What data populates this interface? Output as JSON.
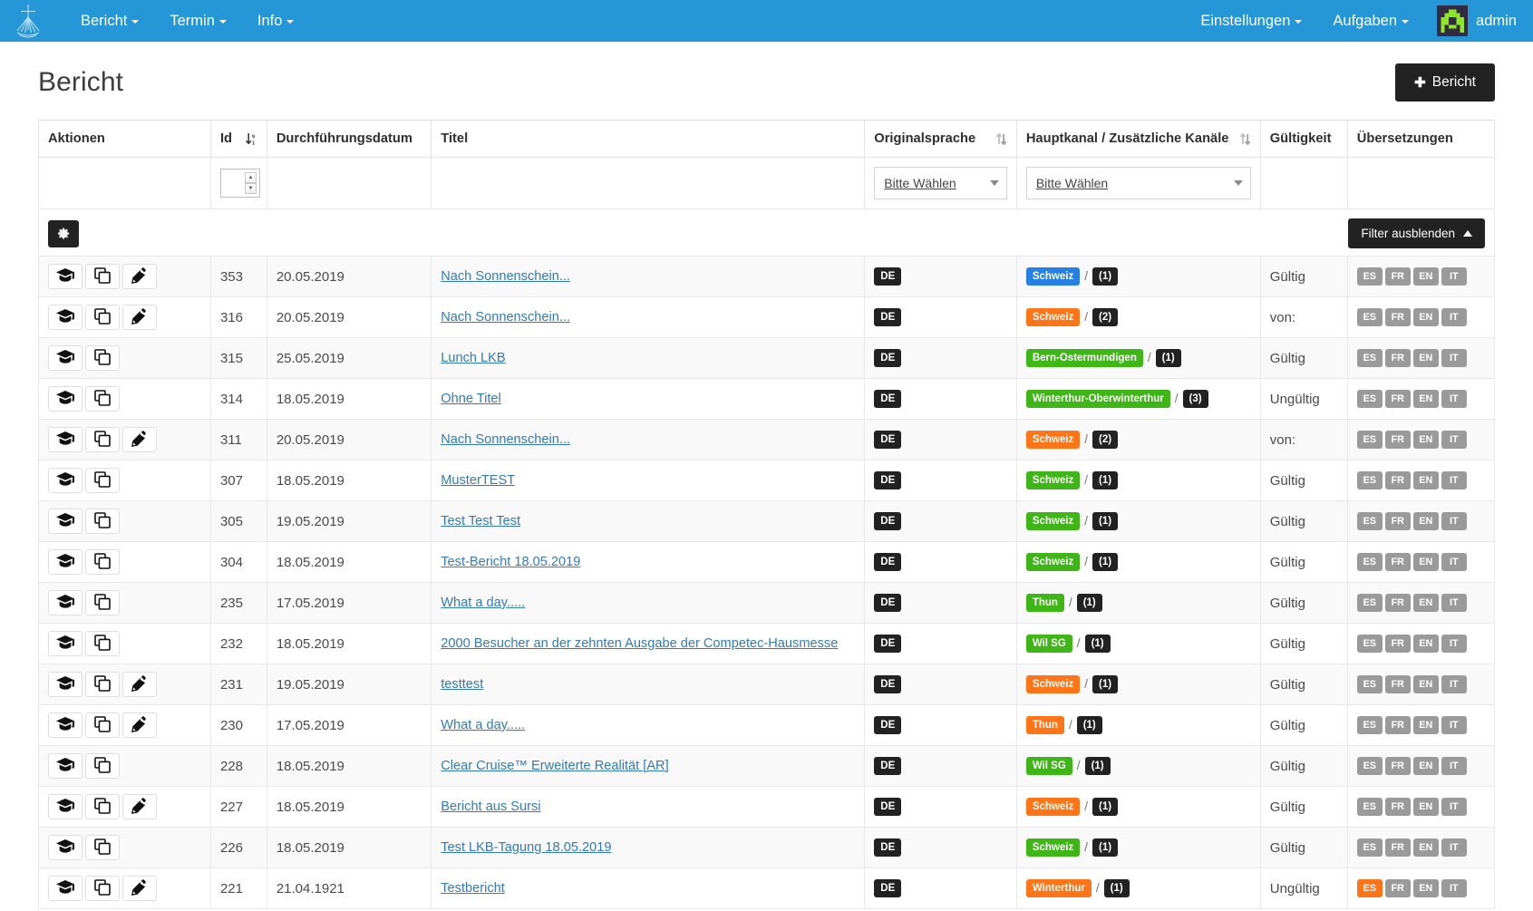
{
  "navbar": {
    "brand_icon": "cross-rays-logo",
    "left_items": [
      {
        "label": "Bericht",
        "icon": "chevron-down-icon"
      },
      {
        "label": "Termin",
        "icon": "chevron-down-icon"
      },
      {
        "label": "Info",
        "icon": "chevron-down-icon"
      }
    ],
    "right_items": [
      {
        "label": "Einstellungen",
        "icon": "chevron-down-icon"
      },
      {
        "label": "Aufgaben",
        "icon": "chevron-down-icon"
      }
    ],
    "username": "admin",
    "bg_color": "#2596d6"
  },
  "page": {
    "title": "Bericht",
    "new_button": {
      "label": "Bericht",
      "icon": "plus-icon"
    }
  },
  "toolbar": {
    "settings_icon": "gear-icon",
    "filter_toggle_label": "Filter ausblenden",
    "filter_toggle_icon": "chevron-up-icon"
  },
  "table": {
    "columns": [
      {
        "label": "Aktionen",
        "sortable": false
      },
      {
        "label": "Id",
        "sortable": true,
        "sort_state": "desc"
      },
      {
        "label": "Durchführungsdatum",
        "sortable": false
      },
      {
        "label": "Titel",
        "sortable": false
      },
      {
        "label": "Originalsprache",
        "sortable": true,
        "sort_state": "none"
      },
      {
        "label": "Hauptkanal / Zusätzliche Kanäle",
        "sortable": true,
        "sort_state": "none"
      },
      {
        "label": "Gültigkeit",
        "sortable": false
      },
      {
        "label": "Übersetzungen",
        "sortable": false
      }
    ],
    "filters": {
      "id_value": "",
      "originalsprache_placeholder": "Bitte Wählen",
      "hauptkanal_placeholder": "Bitte Wählen"
    },
    "rows": [
      {
        "actions": [
          "graduation-cap-icon",
          "copy-icon",
          "pencil-icon"
        ],
        "id": "353",
        "date": "20.05.2019",
        "title": "Nach Sonnenschein...",
        "lang": "DE",
        "channel": "Schweiz",
        "channel_color": "blue",
        "extra_count": "(1)",
        "validity": "Gültig",
        "translations": [
          {
            "label": "ES",
            "color": "gray"
          },
          {
            "label": "FR",
            "color": "gray"
          },
          {
            "label": "EN",
            "color": "gray"
          },
          {
            "label": "IT",
            "color": "gray"
          }
        ]
      },
      {
        "actions": [
          "graduation-cap-icon",
          "copy-icon",
          "pencil-icon"
        ],
        "id": "316",
        "date": "20.05.2019",
        "title": "Nach Sonnenschein...",
        "lang": "DE",
        "channel": "Schweiz",
        "channel_color": "orange",
        "extra_count": "(2)",
        "validity": "von:",
        "translations": [
          {
            "label": "ES",
            "color": "gray"
          },
          {
            "label": "FR",
            "color": "gray"
          },
          {
            "label": "EN",
            "color": "gray"
          },
          {
            "label": "IT",
            "color": "gray"
          }
        ]
      },
      {
        "actions": [
          "graduation-cap-icon",
          "copy-icon"
        ],
        "id": "315",
        "date": "25.05.2019",
        "title": "Lunch LKB",
        "lang": "DE",
        "channel": "Bern-Ostermundigen",
        "channel_color": "green",
        "extra_count": "(1)",
        "validity": "Gültig",
        "translations": [
          {
            "label": "ES",
            "color": "gray"
          },
          {
            "label": "FR",
            "color": "gray"
          },
          {
            "label": "EN",
            "color": "gray"
          },
          {
            "label": "IT",
            "color": "gray"
          }
        ]
      },
      {
        "actions": [
          "graduation-cap-icon",
          "copy-icon"
        ],
        "id": "314",
        "date": "18.05.2019",
        "title": "Ohne Titel",
        "lang": "DE",
        "channel": "Winterthur-Oberwinterthur",
        "channel_color": "green",
        "extra_count": "(3)",
        "validity": "Ungültig",
        "translations": [
          {
            "label": "ES",
            "color": "gray"
          },
          {
            "label": "FR",
            "color": "gray"
          },
          {
            "label": "EN",
            "color": "gray"
          },
          {
            "label": "IT",
            "color": "gray"
          }
        ]
      },
      {
        "actions": [
          "graduation-cap-icon",
          "copy-icon",
          "pencil-icon"
        ],
        "id": "311",
        "date": "20.05.2019",
        "title": "Nach Sonnenschein...",
        "lang": "DE",
        "channel": "Schweiz",
        "channel_color": "orange",
        "extra_count": "(2)",
        "validity": "von:",
        "translations": [
          {
            "label": "ES",
            "color": "gray"
          },
          {
            "label": "FR",
            "color": "gray"
          },
          {
            "label": "EN",
            "color": "gray"
          },
          {
            "label": "IT",
            "color": "gray"
          }
        ]
      },
      {
        "actions": [
          "graduation-cap-icon",
          "copy-icon"
        ],
        "id": "307",
        "date": "18.05.2019",
        "title": "MusterTEST",
        "lang": "DE",
        "channel": "Schweiz",
        "channel_color": "green",
        "extra_count": "(1)",
        "validity": "Gültig",
        "translations": [
          {
            "label": "ES",
            "color": "gray"
          },
          {
            "label": "FR",
            "color": "gray"
          },
          {
            "label": "EN",
            "color": "gray"
          },
          {
            "label": "IT",
            "color": "gray"
          }
        ]
      },
      {
        "actions": [
          "graduation-cap-icon",
          "copy-icon"
        ],
        "id": "305",
        "date": "19.05.2019",
        "title": "Test Test Test",
        "lang": "DE",
        "channel": "Schweiz",
        "channel_color": "green",
        "extra_count": "(1)",
        "validity": "Gültig",
        "translations": [
          {
            "label": "ES",
            "color": "gray"
          },
          {
            "label": "FR",
            "color": "gray"
          },
          {
            "label": "EN",
            "color": "gray"
          },
          {
            "label": "IT",
            "color": "gray"
          }
        ]
      },
      {
        "actions": [
          "graduation-cap-icon",
          "copy-icon"
        ],
        "id": "304",
        "date": "18.05.2019",
        "title": "Test-Bericht 18.05.2019",
        "lang": "DE",
        "channel": "Schweiz",
        "channel_color": "green",
        "extra_count": "(1)",
        "validity": "Gültig",
        "translations": [
          {
            "label": "ES",
            "color": "gray"
          },
          {
            "label": "FR",
            "color": "gray"
          },
          {
            "label": "EN",
            "color": "gray"
          },
          {
            "label": "IT",
            "color": "gray"
          }
        ]
      },
      {
        "actions": [
          "graduation-cap-icon",
          "copy-icon"
        ],
        "id": "235",
        "date": "17.05.2019",
        "title": "What a day.....",
        "lang": "DE",
        "channel": "Thun",
        "channel_color": "green",
        "extra_count": "(1)",
        "validity": "Gültig",
        "translations": [
          {
            "label": "ES",
            "color": "gray"
          },
          {
            "label": "FR",
            "color": "gray"
          },
          {
            "label": "EN",
            "color": "gray"
          },
          {
            "label": "IT",
            "color": "gray"
          }
        ]
      },
      {
        "actions": [
          "graduation-cap-icon",
          "copy-icon"
        ],
        "id": "232",
        "date": "18.05.2019",
        "title": "2000 Besucher an der zehnten Ausgabe der Competec-Hausmesse",
        "lang": "DE",
        "channel": "Wil SG",
        "channel_color": "green",
        "extra_count": "(1)",
        "validity": "Gültig",
        "translations": [
          {
            "label": "ES",
            "color": "gray"
          },
          {
            "label": "FR",
            "color": "gray"
          },
          {
            "label": "EN",
            "color": "gray"
          },
          {
            "label": "IT",
            "color": "gray"
          }
        ]
      },
      {
        "actions": [
          "graduation-cap-icon",
          "copy-icon",
          "pencil-icon"
        ],
        "id": "231",
        "date": "19.05.2019",
        "title": "testtest",
        "lang": "DE",
        "channel": "Schweiz",
        "channel_color": "orange",
        "extra_count": "(1)",
        "validity": "Gültig",
        "translations": [
          {
            "label": "ES",
            "color": "gray"
          },
          {
            "label": "FR",
            "color": "gray"
          },
          {
            "label": "EN",
            "color": "gray"
          },
          {
            "label": "IT",
            "color": "gray"
          }
        ]
      },
      {
        "actions": [
          "graduation-cap-icon",
          "copy-icon",
          "pencil-icon"
        ],
        "id": "230",
        "date": "17.05.2019",
        "title": "What a day.....",
        "lang": "DE",
        "channel": "Thun",
        "channel_color": "orange",
        "extra_count": "(1)",
        "validity": "Gültig",
        "translations": [
          {
            "label": "ES",
            "color": "gray"
          },
          {
            "label": "FR",
            "color": "gray"
          },
          {
            "label": "EN",
            "color": "gray"
          },
          {
            "label": "IT",
            "color": "gray"
          }
        ]
      },
      {
        "actions": [
          "graduation-cap-icon",
          "copy-icon"
        ],
        "id": "228",
        "date": "18.05.2019",
        "title": "Clear Cruise™ Erweiterte Realität [AR]",
        "lang": "DE",
        "channel": "Wil SG",
        "channel_color": "green",
        "extra_count": "(1)",
        "validity": "Gültig",
        "translations": [
          {
            "label": "ES",
            "color": "gray"
          },
          {
            "label": "FR",
            "color": "gray"
          },
          {
            "label": "EN",
            "color": "gray"
          },
          {
            "label": "IT",
            "color": "gray"
          }
        ]
      },
      {
        "actions": [
          "graduation-cap-icon",
          "copy-icon",
          "pencil-icon"
        ],
        "id": "227",
        "date": "18.05.2019",
        "title": "Bericht aus Sursi",
        "lang": "DE",
        "channel": "Schweiz",
        "channel_color": "orange",
        "extra_count": "(1)",
        "validity": "Gültig",
        "translations": [
          {
            "label": "ES",
            "color": "gray"
          },
          {
            "label": "FR",
            "color": "gray"
          },
          {
            "label": "EN",
            "color": "gray"
          },
          {
            "label": "IT",
            "color": "gray"
          }
        ]
      },
      {
        "actions": [
          "graduation-cap-icon",
          "copy-icon"
        ],
        "id": "226",
        "date": "18.05.2019",
        "title": "Test LKB-Tagung 18.05.2019",
        "lang": "DE",
        "channel": "Schweiz",
        "channel_color": "green",
        "extra_count": "(1)",
        "validity": "Gültig",
        "translations": [
          {
            "label": "ES",
            "color": "gray"
          },
          {
            "label": "FR",
            "color": "gray"
          },
          {
            "label": "EN",
            "color": "gray"
          },
          {
            "label": "IT",
            "color": "gray"
          }
        ]
      },
      {
        "actions": [
          "graduation-cap-icon",
          "copy-icon",
          "pencil-icon"
        ],
        "id": "221",
        "date": "21.04.1921",
        "title": "Testbericht",
        "lang": "DE",
        "channel": "Winterthur",
        "channel_color": "orange",
        "extra_count": "(1)",
        "validity": "Ungültig",
        "translations": [
          {
            "label": "ES",
            "color": "orange"
          },
          {
            "label": "FR",
            "color": "gray"
          },
          {
            "label": "EN",
            "color": "gray"
          },
          {
            "label": "IT",
            "color": "gray"
          }
        ]
      }
    ]
  },
  "colors": {
    "brand": "#2596d6",
    "dark": "#222222",
    "blue_badge": "#2780e3",
    "orange_badge": "#ff7518",
    "green_badge": "#3fb618",
    "gray_badge": "#9a9a9a",
    "link": "#337ab7"
  }
}
